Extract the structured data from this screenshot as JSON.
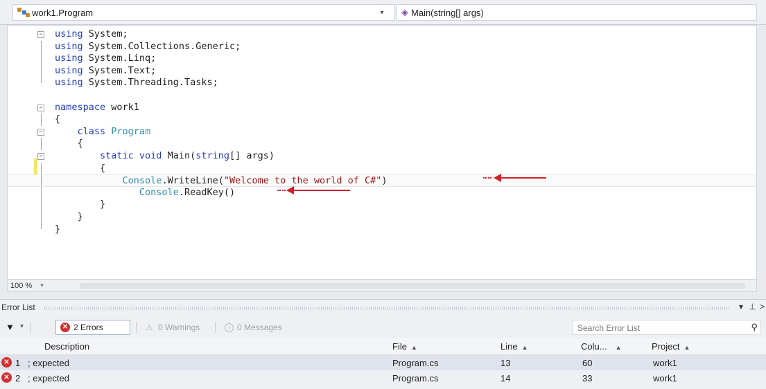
{
  "nav": {
    "class_combo": "work1.Program",
    "member_combo": "Main(string[] args)"
  },
  "code_lines": [
    "using System;",
    "using System.Collections.Generic;",
    "using System.Linq;",
    "using System.Text;",
    "using System.Threading.Tasks;",
    "",
    "namespace work1",
    "{",
    "    class Program",
    "    {",
    "        static void Main(string[] args)",
    "        {",
    "            Console.WriteLine(\"Welcome to the world of C#\")",
    "               Console.ReadKey()",
    "        }",
    "    }",
    "}"
  ],
  "zoom": {
    "level": "100 %"
  },
  "error_list": {
    "title": "Error List",
    "pin_icon": "pin-icon",
    "errors_button": "2 Errors",
    "warnings_button": "0 Warnings",
    "messages_button": "0 Messages",
    "search_placeholder": "Search Error List",
    "columns": {
      "description": "Description",
      "file": "File",
      "line": "Line",
      "column": "Colu...",
      "project": "Project"
    },
    "rows": [
      {
        "num": "1",
        "description": "; expected",
        "file": "Program.cs",
        "line": "13",
        "column": "60",
        "project": "work1"
      },
      {
        "num": "2",
        "description": "; expected",
        "file": "Program.cs",
        "line": "14",
        "column": "33",
        "project": "work1"
      }
    ]
  },
  "colors": {
    "keyword": "#1f3ac0",
    "type": "#2b91af",
    "string": "#a31515",
    "error": "#d23030",
    "annotation_arrow": "#d0202a"
  }
}
